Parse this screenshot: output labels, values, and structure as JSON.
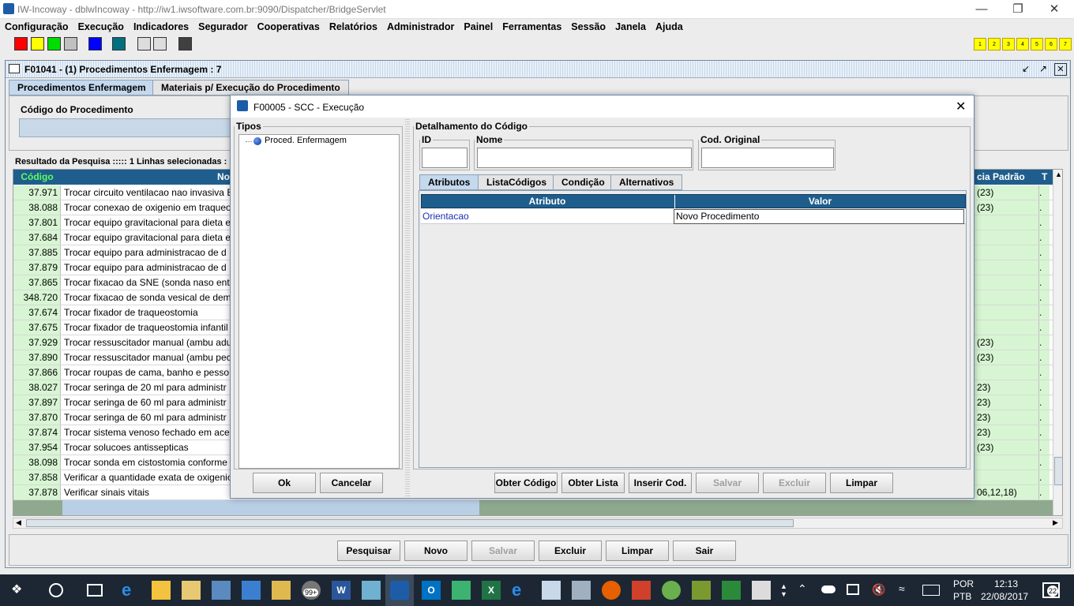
{
  "window": {
    "title": "IW-Incoway - dblwIncoway - http://iw1.iwsoftware.com.br:9090/Dispatcher/BridgeServlet"
  },
  "menu": [
    "Configuração",
    "Execução",
    "Indicadores",
    "Segurador",
    "Cooperativas",
    "Relatórios",
    "Administrador",
    "Painel",
    "Ferramentas",
    "Sessão",
    "Janela",
    "Ajuda"
  ],
  "toolbar": {
    "colors": [
      "#ff0000",
      "#ffff00",
      "#00dd00",
      "#0000ff",
      "#007080",
      "#404040"
    ],
    "numbers": [
      "1",
      "2",
      "3",
      "4",
      "5",
      "6",
      "7"
    ]
  },
  "inner": {
    "title": "F01041 - (1) Procedimentos Enfermagem : 7",
    "tabs": [
      "Procedimentos Enfermagem",
      "Materiais p/ Execução do Procedimento"
    ],
    "codigo_label": "Código do Procedimento",
    "result_label": "Resultado da Pesquisa ::::: 1 Linhas selecionadas :",
    "col_codigo": "Código",
    "col_nome": "No",
    "col_freq": "cia Padrão",
    "col_t": "T",
    "rows": [
      {
        "codigo": "37.971",
        "nome": "Trocar circuito ventilacao nao invasiva E",
        "freq": "(23)",
        "t": "."
      },
      {
        "codigo": "38.088",
        "nome": "Trocar conexao de oxigenio em traqueo",
        "freq": "(23)",
        "t": "."
      },
      {
        "codigo": "37.801",
        "nome": "Trocar equipo gravitacional para dieta e",
        "freq": "",
        "t": "."
      },
      {
        "codigo": "37.684",
        "nome": "Trocar equipo gravitacional para dieta e",
        "freq": "",
        "t": "."
      },
      {
        "codigo": "37.885",
        "nome": "Trocar equipo para administracao de d",
        "freq": "",
        "t": "."
      },
      {
        "codigo": "37.879",
        "nome": "Trocar equipo para administracao de d",
        "freq": "",
        "t": "."
      },
      {
        "codigo": "37.865",
        "nome": "Trocar fixacao da SNE (sonda naso ent",
        "freq": "",
        "t": "."
      },
      {
        "codigo": "348.720",
        "nome": "Trocar fixacao de sonda vesical de dem",
        "freq": "",
        "t": "."
      },
      {
        "codigo": "37.674",
        "nome": "Trocar fixador de traqueostomia",
        "freq": "",
        "t": "."
      },
      {
        "codigo": "37.675",
        "nome": "Trocar fixador de traqueostomia infantil",
        "freq": "",
        "t": "."
      },
      {
        "codigo": "37.929",
        "nome": "Trocar ressuscitador manual (ambu adu",
        "freq": "(23)",
        "t": "."
      },
      {
        "codigo": "37.890",
        "nome": "Trocar ressuscitador manual (ambu pec",
        "freq": "(23)",
        "t": "."
      },
      {
        "codigo": "37.866",
        "nome": "Trocar roupas de cama, banho e pesso",
        "freq": "",
        "t": "."
      },
      {
        "codigo": "38.027",
        "nome": "Trocar seringa de 20 ml para administr",
        "freq": "23)",
        "t": "."
      },
      {
        "codigo": "37.897",
        "nome": "Trocar seringa de 60 ml para administr",
        "freq": "23)",
        "t": "."
      },
      {
        "codigo": "37.870",
        "nome": "Trocar seringa de 60 ml para administr",
        "freq": "23)",
        "t": "."
      },
      {
        "codigo": "37.874",
        "nome": "Trocar sistema venoso fechado em ace",
        "freq": "23)",
        "t": "."
      },
      {
        "codigo": "37.954",
        "nome": "Trocar solucoes antissepticas",
        "freq": "(23)",
        "t": "."
      },
      {
        "codigo": "38.098",
        "nome": "Trocar sonda em cistostomia conforme",
        "freq": "",
        "t": "."
      },
      {
        "codigo": "37.858",
        "nome": "Verificar a quantidade exata de oxigenio",
        "freq": "",
        "t": "."
      },
      {
        "codigo": "37.878",
        "nome": "Verificar sinais vitais",
        "freq": "06,12,18)",
        "t": "."
      }
    ],
    "buttons": {
      "pesquisar": "Pesquisar",
      "novo": "Novo",
      "salvar": "Salvar",
      "excluir": "Excluir",
      "limpar": "Limpar",
      "sair": "Sair"
    }
  },
  "dialog": {
    "title": "F00005 - SCC - Execução",
    "tipos_label": "Tipos",
    "tree_item": "Proced. Enfermagem",
    "detalhe_label": "Detalhamento do Código",
    "id_label": "ID",
    "nome_label": "Nome",
    "cod_original_label": "Cod. Original",
    "id_value": "",
    "nome_value": "",
    "cod_original_value": "",
    "tabs": [
      "Atributos",
      "ListaCódigos",
      "Condição",
      "Alternativos"
    ],
    "col_atributo": "Atributo",
    "col_valor": "Valor",
    "attr_row": {
      "atributo": "Orientacao",
      "valor": "Novo Procedimento"
    },
    "ok": "Ok",
    "cancelar": "Cancelar",
    "obter_codigo": "Obter Código",
    "obter_lista": "Obter Lista",
    "inserir_cod": "Inserir Cod.",
    "salvar": "Salvar",
    "excluir": "Excluir",
    "limpar": "Limpar"
  },
  "taskbar": {
    "badge": "99+",
    "lang1": "POR",
    "lang2": "PTB",
    "time": "12:13",
    "date": "22/08/2017",
    "notif": "22"
  }
}
